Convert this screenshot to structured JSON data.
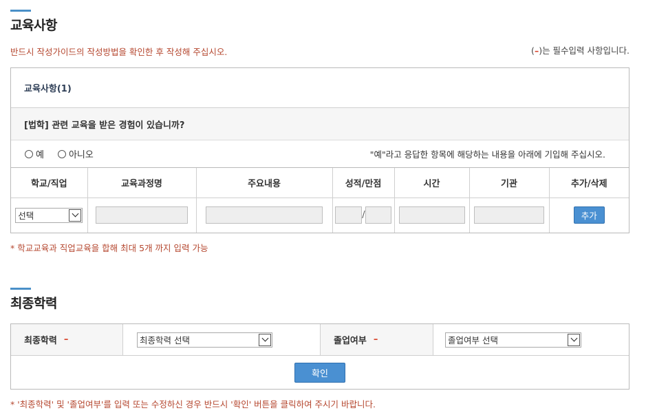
{
  "education": {
    "title": "교육사항",
    "notice": "반드시 작성가이드의 작성방법을 확인한 후 작성해 주십시오.",
    "required_note": {
      "open": "(",
      "mark": "–",
      "text": ")는 필수입력 사항입니다."
    },
    "box_title": "교육사항(1)",
    "question": "[법학] 관련 교육을 받은 경험이 있습니까?",
    "radio_yes": "예",
    "radio_no": "아니오",
    "hint": "\"예\"라고 응답한 항목에 해당하는 내용을 아래에 기입해 주십시오.",
    "columns": [
      "학교/직업",
      "교육과정명",
      "주요내용",
      "성적/만점",
      "시간",
      "기관",
      "추가/삭제"
    ],
    "row": {
      "select_value": "선택",
      "score_sep": "/",
      "add_button": "추가"
    },
    "footnote": "* 학교교육과 직업교육을 합해 최대 5개 까지 입력 가능"
  },
  "final_education": {
    "title": "최종학력",
    "label_degree": "최종학력",
    "degree_select": "최종학력 선택",
    "label_graduation": "졸업여부",
    "graduation_select": "졸업여부 선택",
    "required_mark": "–",
    "confirm_button": "확인",
    "footnote": "* '최종학력' 및 '졸업여부'를 입력 또는 수정하신 경우 반드시 '확인' 버튼을 클릭하여 주시기 바랍니다."
  },
  "colors": {
    "accent": "#4a90c8",
    "notice": "#b5472f",
    "required": "#d9432b",
    "button": "#4a90d2"
  }
}
